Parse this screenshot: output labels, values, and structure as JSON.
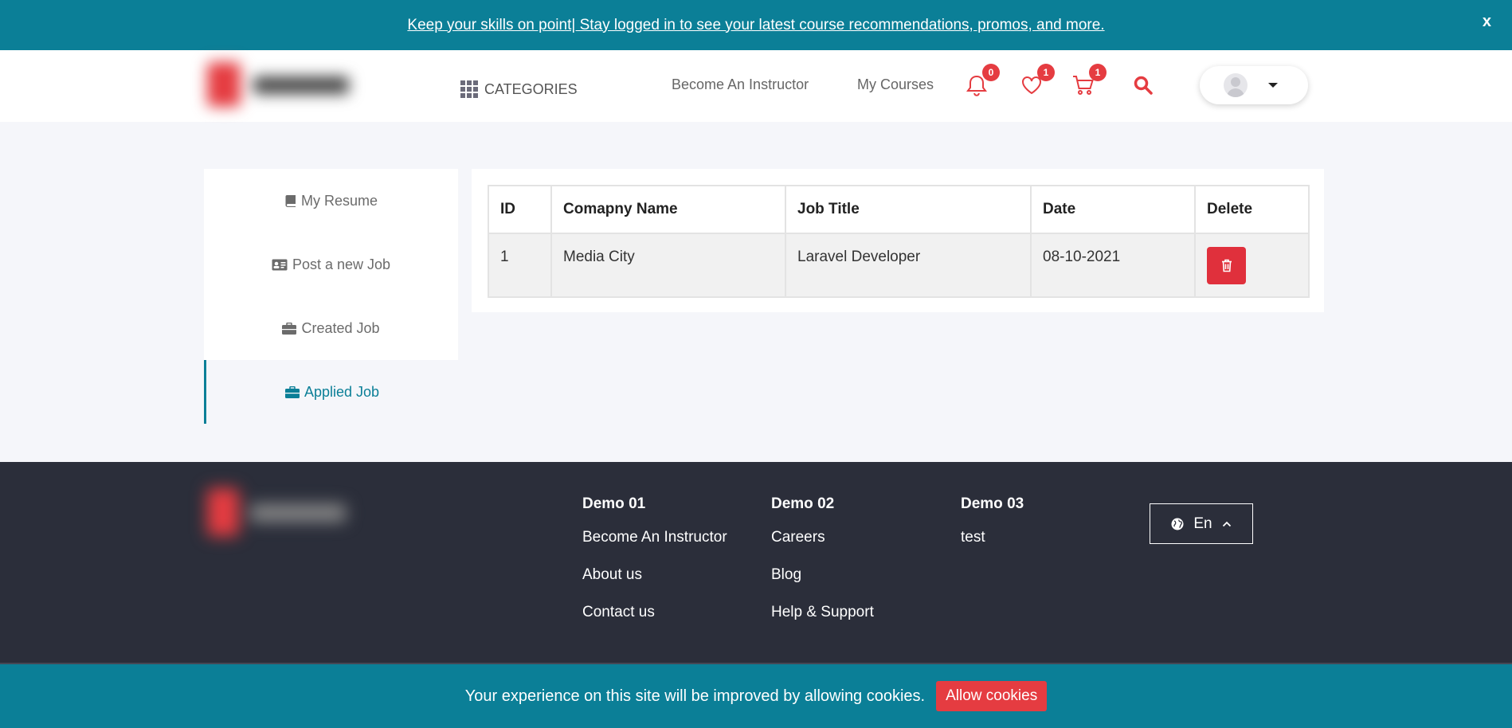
{
  "banner": {
    "text": "Keep your skills on point| Stay logged in to see your latest course recommendations, promos, and more.",
    "close": "x"
  },
  "header": {
    "categories_label": "CATEGORIES",
    "nav": {
      "become_instructor": "Become An Instructor",
      "my_courses": "My Courses"
    },
    "badges": {
      "notifications": "0",
      "wishlist": "1",
      "cart": "1"
    }
  },
  "sidebar": {
    "items": [
      {
        "label": "My Resume",
        "icon": "book-icon"
      },
      {
        "label": "Post a new Job",
        "icon": "id-card-icon"
      },
      {
        "label": "Created Job",
        "icon": "briefcase-icon"
      },
      {
        "label": "Applied Job",
        "icon": "briefcase-icon",
        "active": true
      }
    ]
  },
  "table": {
    "headers": [
      "ID",
      "Comapny Name",
      "Job Title",
      "Date",
      "Delete"
    ],
    "rows": [
      {
        "id": "1",
        "company": "Media City",
        "title": "Laravel Developer",
        "date": "08-10-2021"
      }
    ]
  },
  "footer": {
    "columns": [
      {
        "title": "Demo 01",
        "links": [
          "Become An Instructor",
          "About us",
          "Contact us"
        ]
      },
      {
        "title": "Demo 02",
        "links": [
          "Careers",
          "Blog",
          "Help & Support"
        ]
      },
      {
        "title": "Demo 03",
        "links": [
          "test"
        ]
      }
    ],
    "language": "En"
  },
  "cookie": {
    "message": "Your experience on this site will be improved by allowing cookies.",
    "button": "Allow cookies"
  },
  "colors": {
    "primary": "#0b7f97",
    "accent": "#e53c41",
    "footer_bg": "#2b2e3a",
    "danger": "#e0303c"
  }
}
